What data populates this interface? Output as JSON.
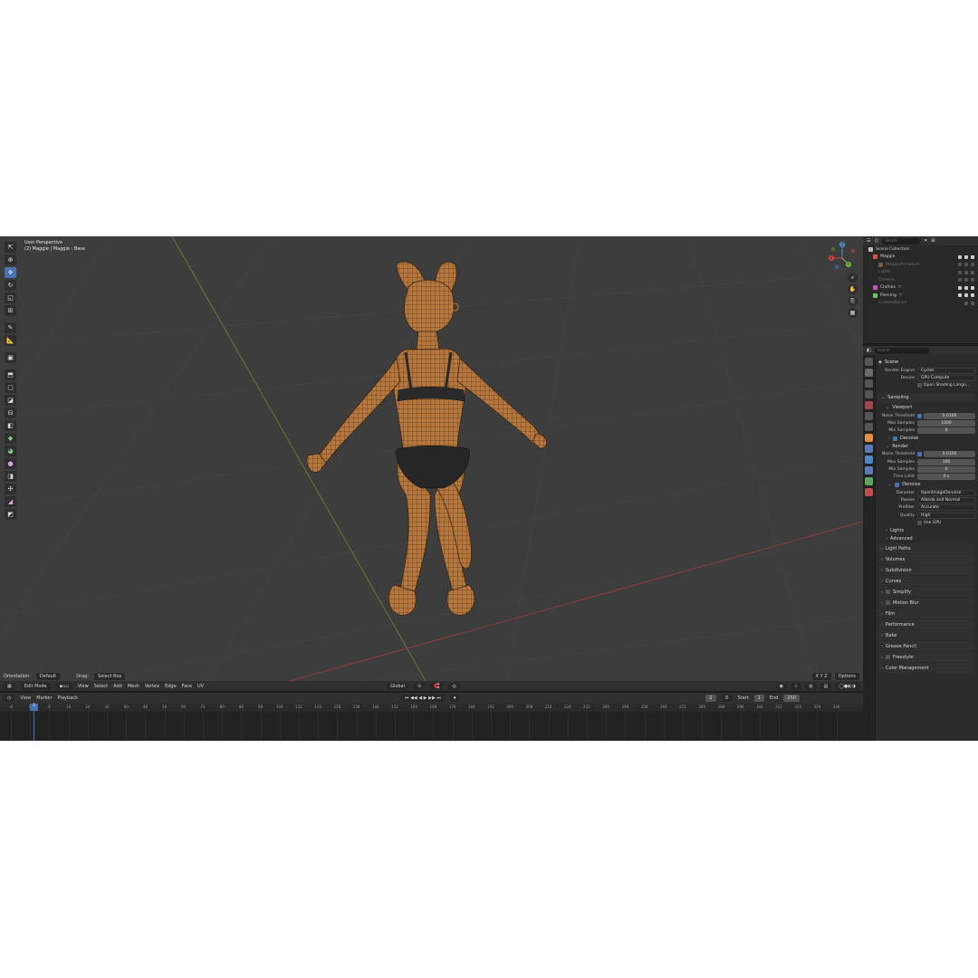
{
  "viewport": {
    "info_line1": "User Perspective",
    "info_line2": "(2) Maggie | Maggie : Base",
    "footer": {
      "orientation_label": "Orientation:",
      "orientation_value": "Default",
      "drag_label": "Drag:",
      "drag_value": "Select Box",
      "options_label": "Options"
    },
    "header": {
      "mode": "Edit Mode",
      "menus": [
        "View",
        "Select",
        "Add",
        "Mesh",
        "Vertex",
        "Edge",
        "Face",
        "UV"
      ],
      "transform_orientation": "Global"
    },
    "gizmo": {
      "x": "X",
      "y": "Y",
      "z": "Z"
    }
  },
  "timeline": {
    "menus": [
      "View",
      "Marker",
      "Playback"
    ],
    "current_frame": "2",
    "start_label": "Start",
    "start_value": "1",
    "end_label": "End",
    "end_value": "250",
    "ruler_ticks": [
      "-8",
      "0",
      "8",
      "16",
      "24",
      "32",
      "40",
      "48",
      "56",
      "64",
      "72",
      "80",
      "88",
      "96",
      "104",
      "112",
      "120",
      "128",
      "136",
      "144",
      "152",
      "160",
      "168",
      "176",
      "184",
      "192",
      "200",
      "208",
      "216",
      "224",
      "232",
      "240",
      "248",
      "256",
      "264",
      "272",
      "280",
      "288",
      "296",
      "304",
      "312",
      "320",
      "328",
      "336"
    ],
    "playhead_label": "2"
  },
  "outliner": {
    "search_placeholder": "Search",
    "items": [
      {
        "name": "Scene Collection",
        "dim": false
      },
      {
        "name": "Maggie",
        "dim": false
      },
      {
        "name": "MaggieArmature",
        "dim": true
      },
      {
        "name": "Lights",
        "dim": true
      },
      {
        "name": "Camera",
        "dim": true
      },
      {
        "name": "Clothes",
        "dim": false
      },
      {
        "name": "Piercing",
        "dim": false
      },
      {
        "name": "CustomBones",
        "dim": true
      }
    ]
  },
  "properties": {
    "search_placeholder": "Search",
    "scene_label": "Scene",
    "render_engine_label": "Render Engine",
    "render_engine_value": "Cycles",
    "device_label": "Device",
    "device_value": "GPU Compute",
    "osl_label": "Open Shading Langu...",
    "sampling": {
      "title": "Sampling",
      "viewport": "Viewport",
      "noise_threshold_label": "Noise Threshold",
      "viewport_noise_threshold": "0.0100",
      "max_samples_label": "Max Samples",
      "viewport_max_samples": "1000",
      "min_samples_label": "Min Samples",
      "viewport_min_samples": "0",
      "denoise_label": "Denoise",
      "render": "Render",
      "render_noise_threshold": "0.0100",
      "render_max_samples": "166",
      "render_min_samples": "0",
      "time_limit_label": "Time Limit",
      "time_limit_value": "0 s",
      "denoiser_label": "Denoiser",
      "denoiser_value": "OpenImageDenoise",
      "passes_label": "Passes",
      "passes_value": "Albedo and Normal",
      "prefilter_label": "Prefilter",
      "prefilter_value": "Accurate",
      "quality_label": "Quality",
      "quality_value": "High",
      "use_gpu_label": "Use GPU",
      "lights": "Lights",
      "advanced": "Advanced"
    },
    "panels": [
      "Light Paths",
      "Volumes",
      "Subdivision",
      "Curves",
      "Simplify",
      "Motion Blur",
      "Film",
      "Performance",
      "Bake",
      "Grease Pencil",
      "Freestyle",
      "Color Management"
    ]
  },
  "colors": {
    "accent": "#4772b3",
    "viewport_bg": "#3d3d3d",
    "model_skin": "#b5773d"
  }
}
